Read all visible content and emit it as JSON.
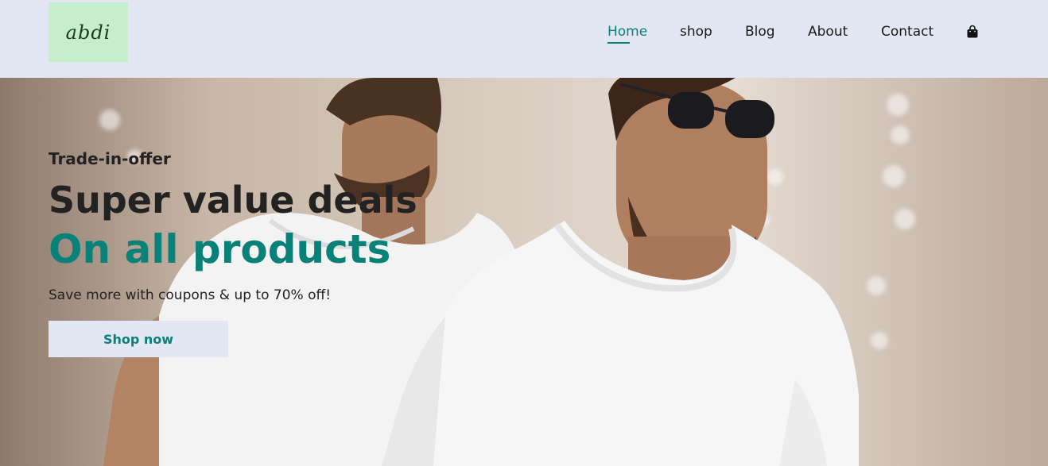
{
  "header": {
    "logo_text": "abdi",
    "nav": [
      {
        "label": "Home",
        "active": true
      },
      {
        "label": "shop",
        "active": false
      },
      {
        "label": "Blog",
        "active": false
      },
      {
        "label": "About",
        "active": false
      },
      {
        "label": "Contact",
        "active": false
      }
    ],
    "cart_icon": "shopping-bag-icon"
  },
  "hero": {
    "pre_title": "Trade-in-offer",
    "title": "Super value deals",
    "highlight": "On all products",
    "subtitle": "Save more with coupons & up to 70% off!",
    "cta_label": "Shop now"
  },
  "colors": {
    "accent": "#088178",
    "header_bg": "#e3e6f3",
    "logo_bg": "#c5eecb"
  }
}
